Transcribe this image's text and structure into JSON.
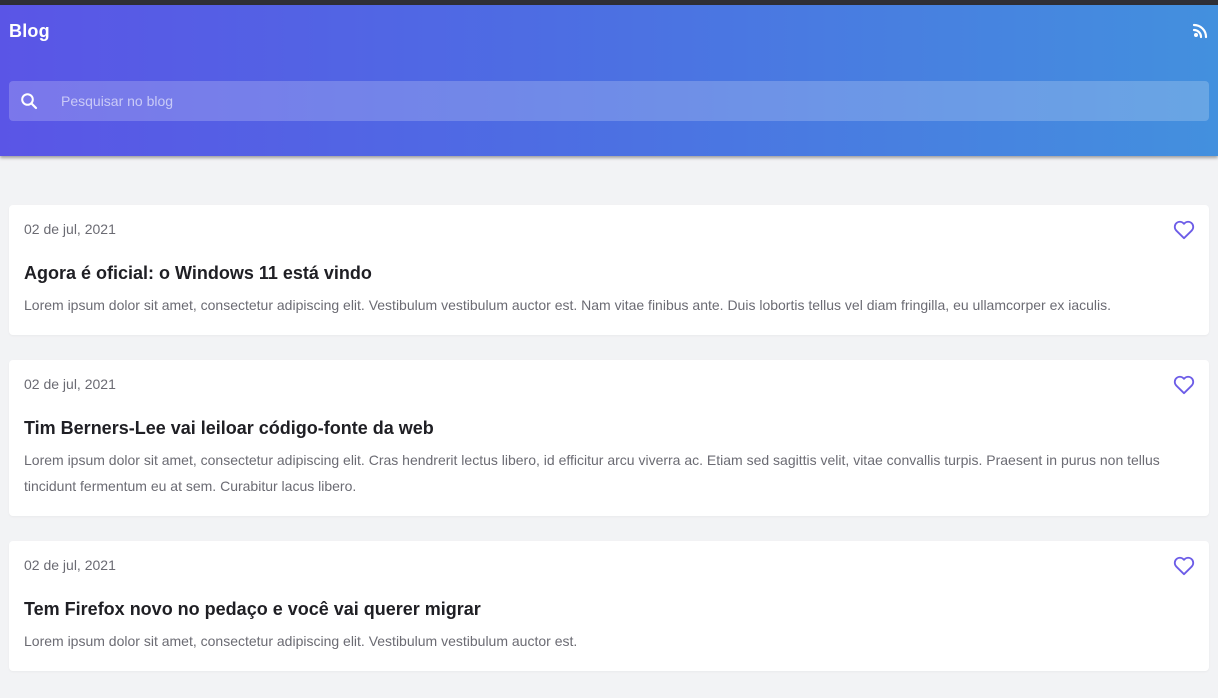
{
  "header": {
    "brand": "Blog",
    "feed_icon": "rss-feed-icon",
    "search_icon": "search-icon"
  },
  "search": {
    "placeholder": "Pesquisar no blog",
    "value": ""
  },
  "colors": {
    "accent": "#6c5ce7",
    "gradient_start": "#5a55e6",
    "gradient_end": "#4390de",
    "background": "#f2f3f5"
  },
  "posts": [
    {
      "date": "02 de jul, 2021",
      "title": "Agora é oficial: o Windows 11 está vindo",
      "excerpt": "Lorem ipsum dolor sit amet, consectetur adipiscing elit. Vestibulum vestibulum auctor est. Nam vitae finibus ante. Duis lobortis tellus vel diam fringilla, eu ullamcorper ex iaculis.",
      "like_icon": "heart-outline-icon"
    },
    {
      "date": "02 de jul, 2021",
      "title": "Tim Berners-Lee vai leiloar código-fonte da web",
      "excerpt": "Lorem ipsum dolor sit amet, consectetur adipiscing elit. Cras hendrerit lectus libero, id efficitur arcu viverra ac. Etiam sed sagittis velit, vitae convallis turpis. Praesent in purus non tellus tincidunt fermentum eu at sem. Curabitur lacus libero.",
      "like_icon": "heart-outline-icon"
    },
    {
      "date": "02 de jul, 2021",
      "title": "Tem Firefox novo no pedaço e você vai querer migrar",
      "excerpt": "Lorem ipsum dolor sit amet, consectetur adipiscing elit. Vestibulum vestibulum auctor est.",
      "like_icon": "heart-outline-icon"
    }
  ]
}
